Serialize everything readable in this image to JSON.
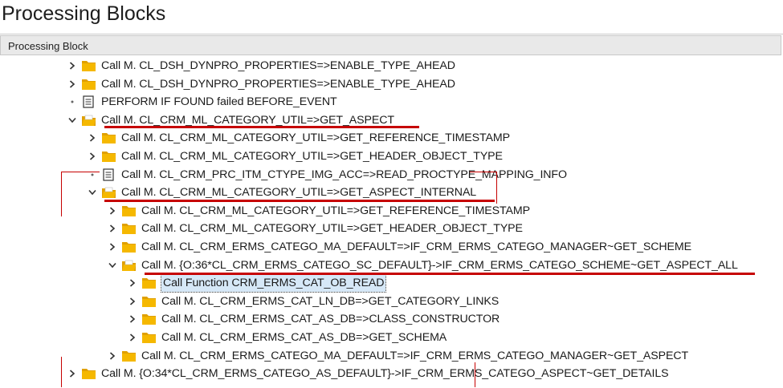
{
  "page": {
    "title": "Processing Blocks"
  },
  "table": {
    "column_header": "Processing Block"
  },
  "rows": [
    {
      "label": "Call M. CL_DSH_DYNPRO_PROPERTIES=>ENABLE_TYPE_AHEAD",
      "icon": "folder-icon",
      "state": "collapsed"
    },
    {
      "label": "Call M. CL_DSH_DYNPRO_PROPERTIES=>ENABLE_TYPE_AHEAD",
      "icon": "folder-icon",
      "state": "collapsed"
    },
    {
      "label": "PERFORM IF FOUND failed BEFORE_EVENT",
      "icon": "document-icon",
      "state": "leaf"
    },
    {
      "label": "Call M. CL_CRM_ML_CATEGORY_UTIL=>GET_ASPECT",
      "icon": "folder-open-icon",
      "state": "expanded"
    },
    {
      "label": "Call M. CL_CRM_ML_CATEGORY_UTIL=>GET_REFERENCE_TIMESTAMP",
      "icon": "folder-icon",
      "state": "collapsed"
    },
    {
      "label": "Call M. CL_CRM_ML_CATEGORY_UTIL=>GET_HEADER_OBJECT_TYPE",
      "icon": "folder-icon",
      "state": "collapsed"
    },
    {
      "label": "Call M. CL_CRM_PRC_ITM_CTYPE_IMG_ACC=>READ_PROCTYPE_MAPPING_INFO",
      "icon": "document-icon",
      "state": "leaf"
    },
    {
      "label": "Call M. CL_CRM_ML_CATEGORY_UTIL=>GET_ASPECT_INTERNAL",
      "icon": "folder-open-icon",
      "state": "expanded"
    },
    {
      "label": "Call M. CL_CRM_ML_CATEGORY_UTIL=>GET_REFERENCE_TIMESTAMP",
      "icon": "folder-icon",
      "state": "collapsed"
    },
    {
      "label": "Call M. CL_CRM_ML_CATEGORY_UTIL=>GET_HEADER_OBJECT_TYPE",
      "icon": "folder-icon",
      "state": "collapsed"
    },
    {
      "label": "Call M. CL_CRM_ERMS_CATEGO_MA_DEFAULT=>IF_CRM_ERMS_CATEGO_MANAGER~GET_SCHEME",
      "icon": "folder-icon",
      "state": "collapsed"
    },
    {
      "label": "Call M. {O:36*CL_CRM_ERMS_CATEGO_SC_DEFAULT}->IF_CRM_ERMS_CATEGO_SCHEME~GET_ASPECT_ALL",
      "icon": "folder-open-icon",
      "state": "expanded"
    },
    {
      "label": "Call Function CRM_ERMS_CAT_OB_READ",
      "icon": "folder-icon",
      "state": "collapsed",
      "selected": true
    },
    {
      "label": "Call M. CL_CRM_ERMS_CAT_LN_DB=>GET_CATEGORY_LINKS",
      "icon": "folder-icon",
      "state": "collapsed"
    },
    {
      "label": "Call M. CL_CRM_ERMS_CAT_AS_DB=>CLASS_CONSTRUCTOR",
      "icon": "folder-icon",
      "state": "collapsed"
    },
    {
      "label": "Call M. CL_CRM_ERMS_CAT_AS_DB=>GET_SCHEMA",
      "icon": "folder-icon",
      "state": "collapsed"
    },
    {
      "label": "Call M. CL_CRM_ERMS_CATEGO_MA_DEFAULT=>IF_CRM_ERMS_CATEGO_MANAGER~GET_ASPECT",
      "icon": "folder-icon",
      "state": "collapsed"
    },
    {
      "label": "Call M. {O:34*CL_CRM_ERMS_CATEGO_AS_DEFAULT}->IF_CRM_ERMS_CATEGO_ASPECT~GET_DETAILS",
      "icon": "folder-icon",
      "state": "collapsed"
    }
  ],
  "colors": {
    "folder": "#f5b800",
    "folder_dark": "#e0a000",
    "annotation": "#c60000",
    "selection": "#d6e8f7"
  }
}
